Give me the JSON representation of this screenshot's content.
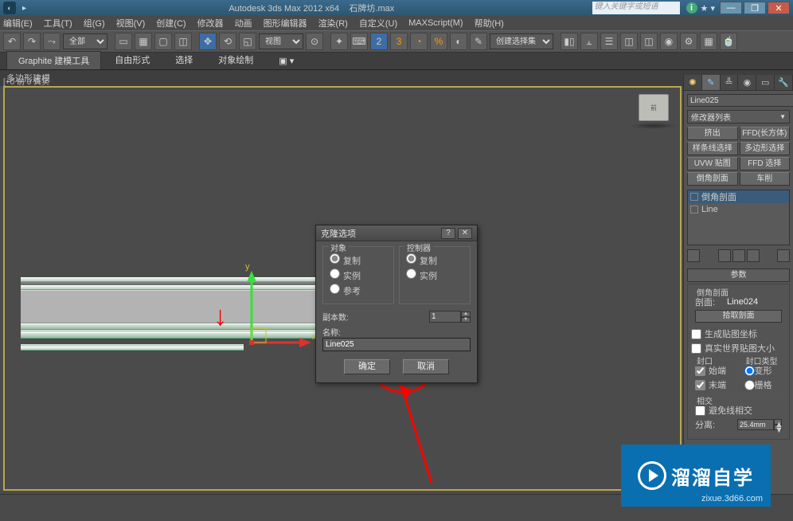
{
  "title": {
    "app": "Autodesk 3ds Max  2012 x64",
    "file": "石牌坊.max"
  },
  "search_placeholder": "键入关键字或短语",
  "menu": [
    "编辑(E)",
    "工具(T)",
    "组(G)",
    "视图(V)",
    "创建(C)",
    "修改器",
    "动画",
    "图形编辑器",
    "渲染(R)",
    "自定义(U)",
    "MAXScript(M)",
    "帮助(H)"
  ],
  "toolbar": {
    "allsel": "全部",
    "viewsel": "视图",
    "selset": "创建选择集"
  },
  "ribbon": {
    "tabs": [
      "Graphite 建模工具",
      "自由形式",
      "选择",
      "对象绘制"
    ],
    "sub": "多边形建模"
  },
  "viewport": {
    "label": "[+0 前 0 真实"
  },
  "dialog": {
    "title": "克隆选项",
    "grp_object": "对象",
    "opt": {
      "copy": "复制",
      "instance": "实例",
      "reference": "参考"
    },
    "grp_ctrl": "控制器",
    "copies_label": "副本数:",
    "copies": "1",
    "name_label": "名称:",
    "name_value": "Line025",
    "ok": "确定",
    "cancel": "取消"
  },
  "panel": {
    "objname": "Line025",
    "modifier_list": "修改器列表",
    "buttons": {
      "extrude": "挤出",
      "ffd": "FFD(长方体)",
      "spline": "样条线选择",
      "poly": "多边形选择",
      "uvw": "UVW 贴图",
      "ffdsel": "FFD 选择",
      "chamfer": "倒角剖面",
      "lathe": "车削"
    },
    "stack": {
      "item1": "倒角剖面",
      "item2": "Line"
    },
    "roll_params": "参数",
    "sec": {
      "title": "倒角剖面",
      "lbl": "剖面:",
      "val": "Line024",
      "pick": "拾取剖面"
    },
    "capping": {
      "gen": "生成贴图坐标",
      "real": "真实世界贴图大小"
    },
    "cap": {
      "title": "封口",
      "start": "始端",
      "end": "末端",
      "typ": "封口类型",
      "morph": "变形",
      "grid": "栅格"
    },
    "intersect": {
      "title": "相交",
      "avoid": "避免线相交",
      "sep_lbl": "分离:",
      "sep_val": "25.4mm"
    }
  },
  "watermark": {
    "brand": "溜溜自学",
    "url": "zixue.3d66.com"
  }
}
